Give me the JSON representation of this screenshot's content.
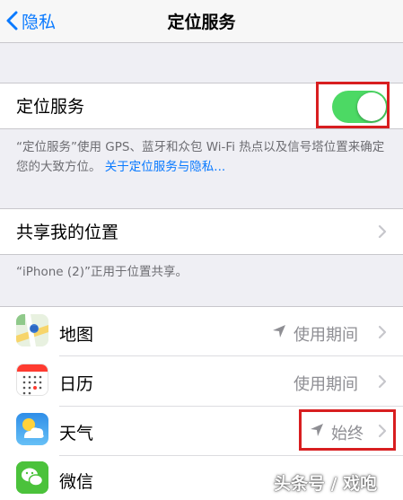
{
  "nav": {
    "back_label": "隐私",
    "title": "定位服务"
  },
  "location_services": {
    "label": "定位服务",
    "enabled": true,
    "accent_color": "#4cd964",
    "footer_text": "“定位服务”使用 GPS、蓝牙和众包 Wi-Fi 热点以及信号塔位置来确定您的大致方位。",
    "footer_link": "关于定位服务与隐私..."
  },
  "share_location": {
    "label": "共享我的位置",
    "footer_text": "“iPhone (2)”正用于位置共享。"
  },
  "apps": [
    {
      "name": "地图",
      "icon": "maps-icon",
      "value": "使用期间",
      "location_arrow": true
    },
    {
      "name": "日历",
      "icon": "calendar-icon",
      "value": "使用期间",
      "location_arrow": false
    },
    {
      "name": "天气",
      "icon": "weather-icon",
      "value": "始终",
      "location_arrow": true
    },
    {
      "name": "微信",
      "icon": "wechat-icon",
      "value": "",
      "location_arrow": false
    }
  ],
  "highlight_color": "#d81e20",
  "watermark": "头条号 / 戏咆"
}
